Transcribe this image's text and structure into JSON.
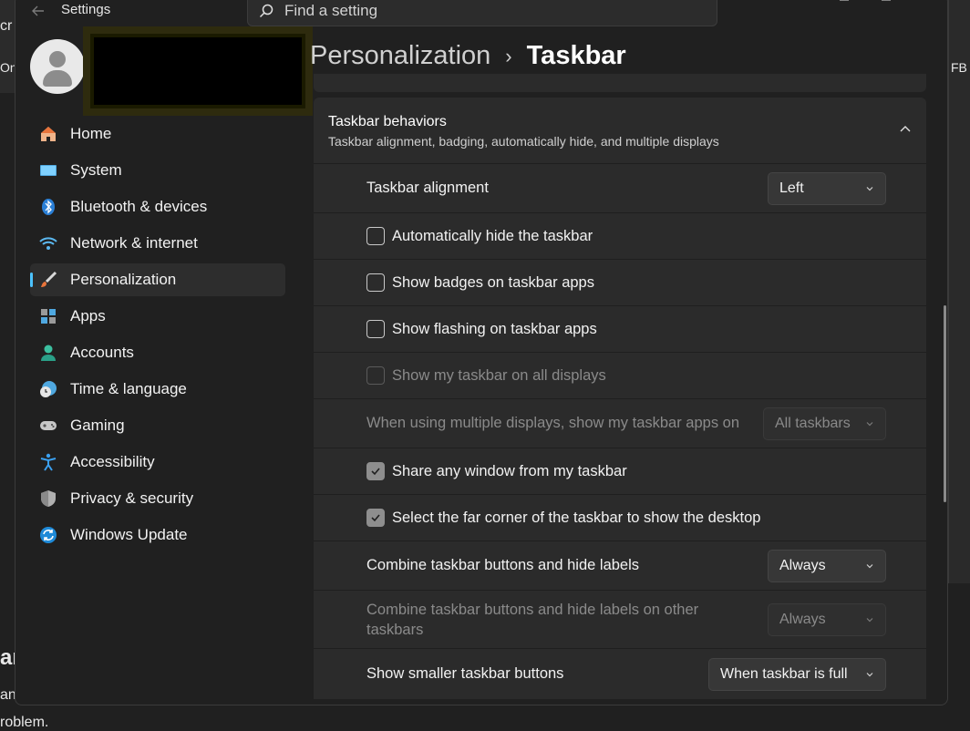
{
  "background": {
    "left_fragments": [
      "cr",
      "On",
      "ar",
      "an"
    ],
    "bottom_text": "roblem.",
    "right_fragment": "FB"
  },
  "window": {
    "title": "Settings",
    "search_placeholder": "Find a setting"
  },
  "breadcrumb": {
    "parent": "Personalization",
    "separator": "›",
    "current": "Taskbar"
  },
  "sidebar": {
    "items": [
      {
        "label": "Home",
        "icon": "home-icon"
      },
      {
        "label": "System",
        "icon": "system-icon"
      },
      {
        "label": "Bluetooth & devices",
        "icon": "bluetooth-icon"
      },
      {
        "label": "Network & internet",
        "icon": "wifi-icon"
      },
      {
        "label": "Personalization",
        "icon": "brush-icon",
        "active": true
      },
      {
        "label": "Apps",
        "icon": "apps-icon"
      },
      {
        "label": "Accounts",
        "icon": "accounts-icon"
      },
      {
        "label": "Time & language",
        "icon": "clock-globe-icon"
      },
      {
        "label": "Gaming",
        "icon": "gamepad-icon"
      },
      {
        "label": "Accessibility",
        "icon": "accessibility-icon"
      },
      {
        "label": "Privacy & security",
        "icon": "shield-icon"
      },
      {
        "label": "Windows Update",
        "icon": "update-icon"
      }
    ]
  },
  "section": {
    "title": "Taskbar behaviors",
    "subtitle": "Taskbar alignment, badging, automatically hide, and multiple displays"
  },
  "settings": {
    "alignment": {
      "label": "Taskbar alignment",
      "value": "Left"
    },
    "auto_hide": {
      "label": "Automatically hide the taskbar",
      "checked": false
    },
    "badges": {
      "label": "Show badges on taskbar apps",
      "checked": false
    },
    "flashing": {
      "label": "Show flashing on taskbar apps",
      "checked": false
    },
    "all_displays": {
      "label": "Show my taskbar on all displays",
      "checked": false,
      "disabled": true
    },
    "multi_display": {
      "label": "When using multiple displays, show my taskbar apps on",
      "value": "All taskbars",
      "disabled": true
    },
    "share_window": {
      "label": "Share any window from my taskbar",
      "checked": true
    },
    "far_corner": {
      "label": "Select the far corner of the taskbar to show the desktop",
      "checked": true
    },
    "combine": {
      "label": "Combine taskbar buttons and hide labels",
      "value": "Always"
    },
    "combine_other": {
      "label": "Combine taskbar buttons and hide labels on other taskbars",
      "value": "Always",
      "disabled": true
    },
    "smaller_buttons": {
      "label": "Show smaller taskbar buttons",
      "value": "When taskbar is full"
    }
  },
  "colors": {
    "accent": "#4cc2ff",
    "window_bg": "#202020",
    "card_bg": "#2b2b2b"
  }
}
